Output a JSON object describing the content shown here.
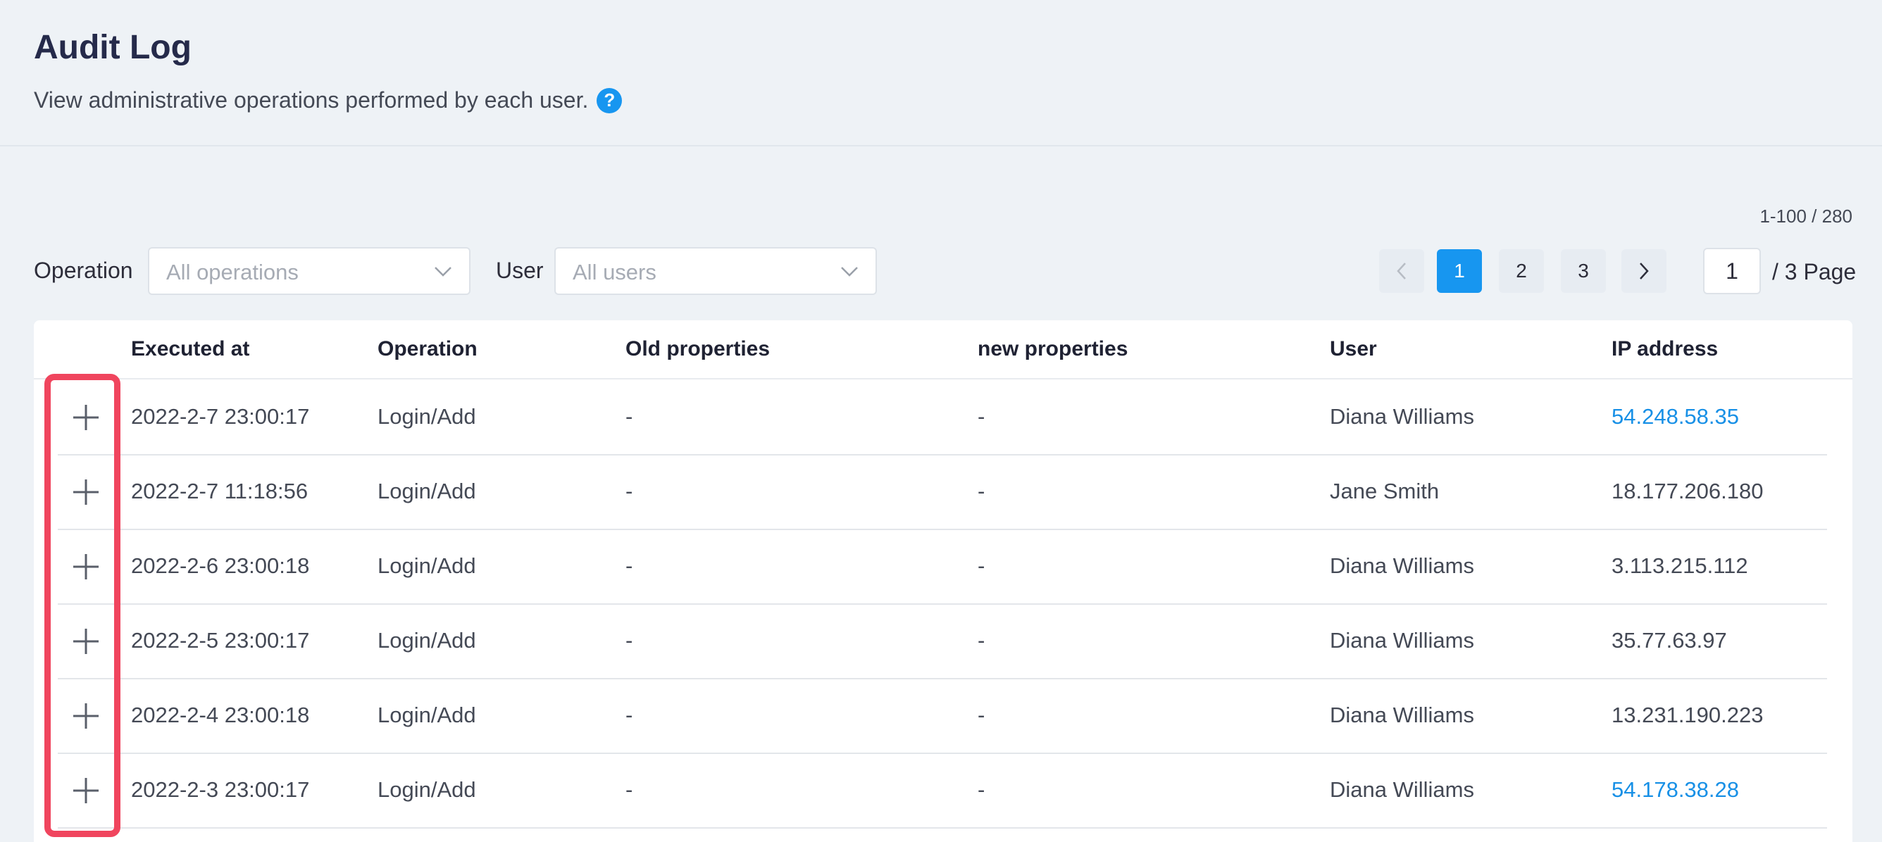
{
  "header": {
    "title": "Audit Log",
    "subtitle": "View administrative operations performed by each user.",
    "help_icon": "question-circle-icon"
  },
  "range_count": "1-100 / 280",
  "filters": {
    "operation_label": "Operation",
    "operation_placeholder": "All operations",
    "user_label": "User",
    "user_placeholder": "All users"
  },
  "pagination": {
    "prev_icon": "chevron-left-icon",
    "next_icon": "chevron-right-icon",
    "pages": [
      "1",
      "2",
      "3"
    ],
    "current_page": "1",
    "page_input": "1",
    "total_label": "/ 3 Page"
  },
  "table": {
    "columns": [
      "Executed at",
      "Operation",
      "Old properties",
      "new properties",
      "User",
      "IP address"
    ],
    "rows": [
      {
        "executed_at": "2022-2-7 23:00:17",
        "operation": "Login/Add",
        "old": "-",
        "new": "-",
        "user": "Diana Williams",
        "ip": "54.248.58.35",
        "ip_link": true
      },
      {
        "executed_at": "2022-2-7 11:18:56",
        "operation": "Login/Add",
        "old": "-",
        "new": "-",
        "user": "Jane Smith",
        "ip": "18.177.206.180",
        "ip_link": false
      },
      {
        "executed_at": "2022-2-6 23:00:18",
        "operation": "Login/Add",
        "old": "-",
        "new": "-",
        "user": "Diana Williams",
        "ip": "3.113.215.112",
        "ip_link": false
      },
      {
        "executed_at": "2022-2-5 23:00:17",
        "operation": "Login/Add",
        "old": "-",
        "new": "-",
        "user": "Diana Williams",
        "ip": "35.77.63.97",
        "ip_link": false
      },
      {
        "executed_at": "2022-2-4 23:00:18",
        "operation": "Login/Add",
        "old": "-",
        "new": "-",
        "user": "Diana Williams",
        "ip": "13.231.190.223",
        "ip_link": false
      },
      {
        "executed_at": "2022-2-3 23:00:17",
        "operation": "Login/Add",
        "old": "-",
        "new": "-",
        "user": "Diana Williams",
        "ip": "54.178.38.28",
        "ip_link": true
      }
    ]
  },
  "colors": {
    "accent": "#1796f0",
    "link": "#1890e6",
    "highlight": "#f0455e",
    "background": "#eef2f6"
  }
}
